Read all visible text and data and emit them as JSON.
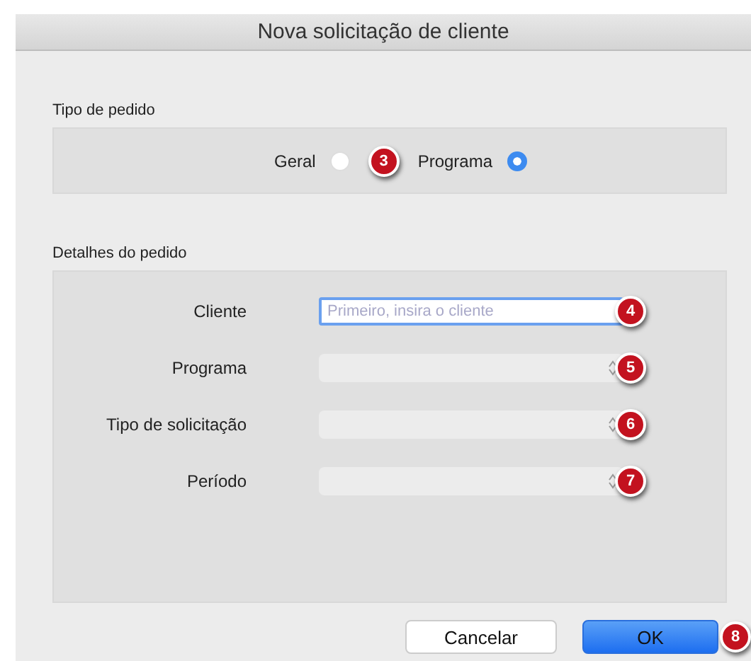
{
  "window": {
    "title": "Nova solicitação de cliente"
  },
  "order_type": {
    "label": "Tipo de pedido",
    "badge": "3",
    "options": [
      {
        "label": "Geral",
        "selected": false
      },
      {
        "label": "Programa",
        "selected": true
      }
    ]
  },
  "details": {
    "label": "Detalhes do pedido",
    "fields": [
      {
        "kind": "text",
        "label": "Cliente",
        "placeholder": "Primeiro, insira o cliente",
        "badge": "4"
      },
      {
        "kind": "select",
        "label": "Programa",
        "badge": "5"
      },
      {
        "kind": "select",
        "label": "Tipo de solicitação",
        "badge": "6"
      },
      {
        "kind": "select",
        "label": "Período",
        "badge": "7"
      }
    ]
  },
  "buttons": [
    {
      "label": "Cancelar",
      "kind": "default"
    },
    {
      "label": "OK",
      "kind": "primary",
      "badge": "8"
    }
  ]
}
